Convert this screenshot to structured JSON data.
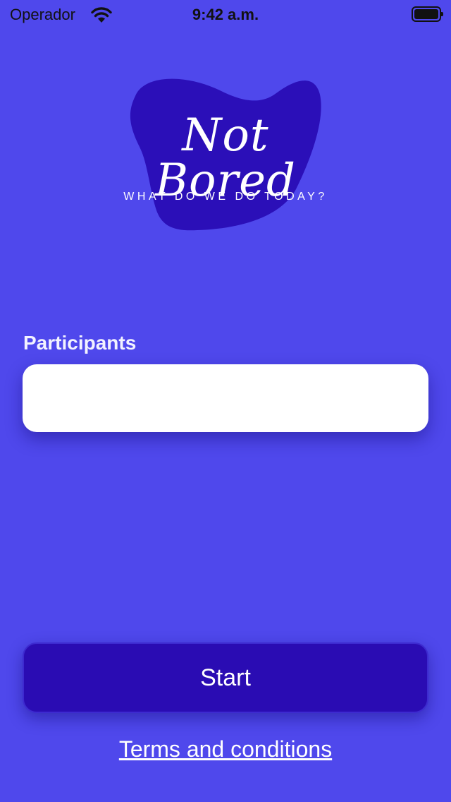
{
  "status_bar": {
    "carrier": "Operador",
    "time": "9:42 a.m."
  },
  "logo": {
    "title": "Not Bored",
    "tagline": "WHAT DO WE DO TODAY?"
  },
  "form": {
    "participants_label": "Participants",
    "participants_value": "",
    "participants_placeholder": ""
  },
  "actions": {
    "start_label": "Start",
    "terms_label": "Terms and conditions"
  },
  "colors": {
    "background": "#4f48ec",
    "logo_blob": "#2b0fb8",
    "button": "#2a0cb3"
  },
  "icons": [
    "wifi-icon",
    "battery-icon"
  ]
}
